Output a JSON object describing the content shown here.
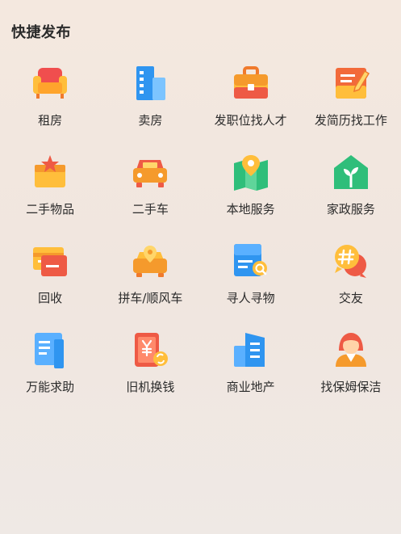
{
  "section": {
    "title": "快捷发布"
  },
  "items": [
    {
      "label": "租房",
      "icon": "armchair-icon"
    },
    {
      "label": "卖房",
      "icon": "building-icon"
    },
    {
      "label": "发职位找人才",
      "icon": "briefcase-icon"
    },
    {
      "label": "发简历找工作",
      "icon": "resume-pencil-icon"
    },
    {
      "label": "二手物品",
      "icon": "star-box-icon"
    },
    {
      "label": "二手车",
      "icon": "car-icon"
    },
    {
      "label": "本地服务",
      "icon": "map-pin-icon"
    },
    {
      "label": "家政服务",
      "icon": "house-sprout-icon"
    },
    {
      "label": "回收",
      "icon": "recycle-card-icon"
    },
    {
      "label": "拼车/顺风车",
      "icon": "car-pin-icon"
    },
    {
      "label": "寻人寻物",
      "icon": "search-document-icon"
    },
    {
      "label": "交友",
      "icon": "hashtag-chat-icon"
    },
    {
      "label": "万能求助",
      "icon": "help-document-icon"
    },
    {
      "label": "旧机换钱",
      "icon": "phone-exchange-icon"
    },
    {
      "label": "商业地产",
      "icon": "office-buildings-icon"
    },
    {
      "label": "找保姆保洁",
      "icon": "nanny-icon"
    }
  ],
  "colors": {
    "orange": "#f59a2c",
    "yellow": "#ffc43d",
    "red": "#ee5a45",
    "blue": "#2f95f0",
    "green": "#2fbe7a",
    "teal": "#3cc9a0"
  }
}
